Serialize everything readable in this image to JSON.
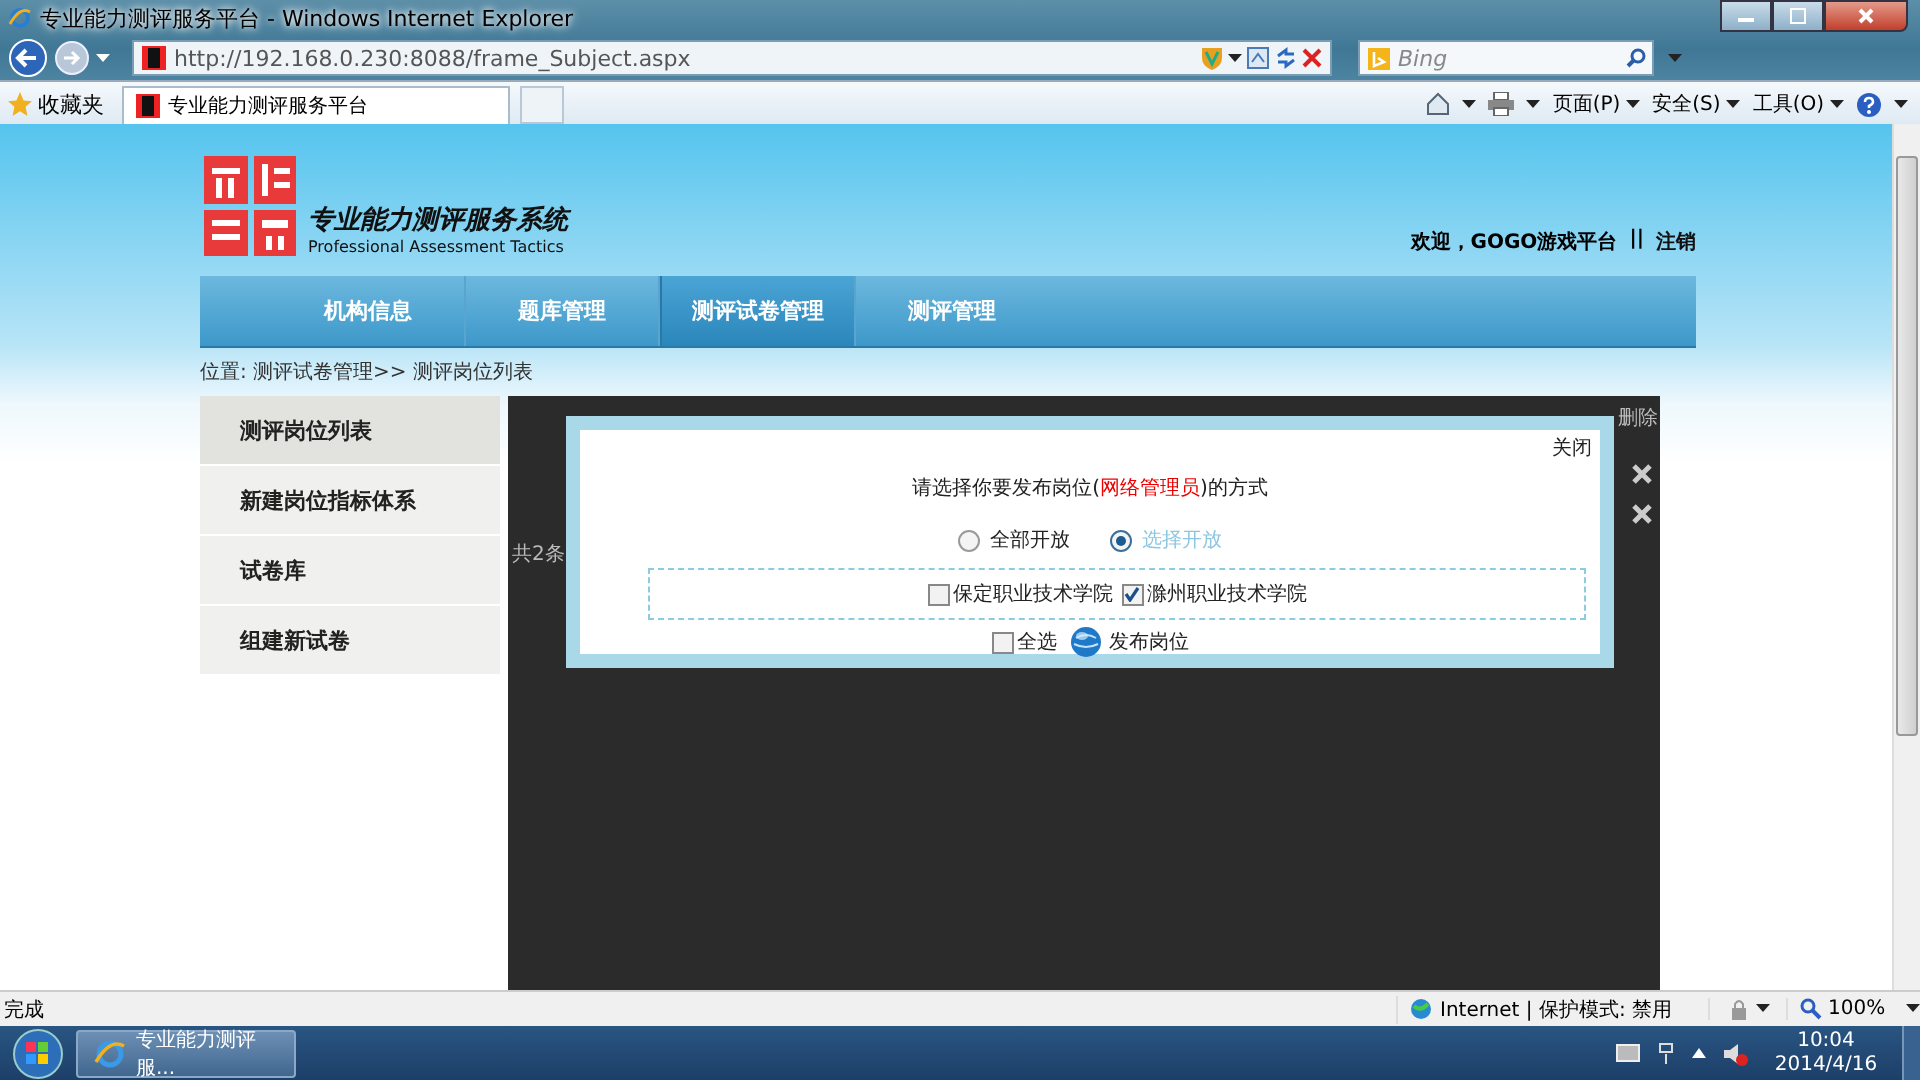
{
  "window": {
    "title": "专业能力测评服务平台 - Windows Internet Explorer"
  },
  "address_bar": {
    "url": "http://192.168.0.230:8088/frame_Subject.aspx"
  },
  "search": {
    "placeholder": "Bing"
  },
  "favorites": {
    "label": "收藏夹"
  },
  "tabs": [
    {
      "label": "专业能力测评服务平台",
      "selected": true
    }
  ],
  "command_bar": [
    "页面(P)",
    "安全(S)",
    "工具(O)"
  ],
  "site": {
    "title": "专业能力测评服务系统",
    "subtitle": "Professional Assessment Tactics",
    "welcome": "欢迎，GOGO游戏平台",
    "separator": "||",
    "logout": "注销"
  },
  "nav": [
    {
      "label": "机构信息",
      "selected": false
    },
    {
      "label": "题库管理",
      "selected": false
    },
    {
      "label": "测评试卷管理",
      "selected": true
    },
    {
      "label": "测评管理",
      "selected": false
    }
  ],
  "breadcrumb": "位置: 测评试卷管理>> 测评岗位列表",
  "sidebar": [
    {
      "label": "测评岗位列表",
      "selected": true
    },
    {
      "label": "新建岗位指标体系",
      "selected": false
    },
    {
      "label": "试卷库",
      "selected": false
    },
    {
      "label": "组建新试卷",
      "selected": false
    }
  ],
  "background_table": {
    "column_7": "删除",
    "count": "共2条"
  },
  "dialog": {
    "close": "关闭",
    "prompt": [
      {
        "text": "请选择你要发布岗位(",
        "highlight": false
      },
      {
        "text": "网络管理员",
        "highlight": true
      },
      {
        "text": ")的方式",
        "highlight": false
      }
    ],
    "options": [
      {
        "label": "全部开放",
        "selected": false
      },
      {
        "label": "选择开放",
        "selected": true
      }
    ],
    "schools": [
      {
        "label": "保定职业技术学院",
        "checked": false
      },
      {
        "label": "滁州职业技术学院",
        "checked": true
      }
    ],
    "select_all": {
      "label": "全选",
      "checked": false
    },
    "publish": "发布岗位"
  },
  "status_bar": {
    "text": "完成",
    "zone": "Internet | 保护模式: 禁用",
    "zoom": "100%"
  },
  "taskbar": {
    "task": "专业能力测评服...",
    "time": "10:04",
    "date": "2014/4/16"
  }
}
